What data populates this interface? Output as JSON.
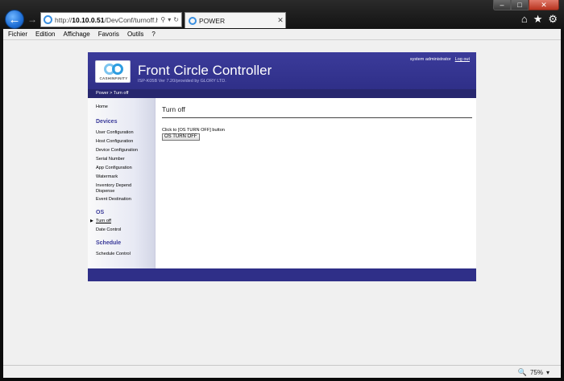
{
  "browser": {
    "address_prefix": "http://",
    "address_host": "10.10.0.51",
    "address_path": "/DevConf/turnoff.htm",
    "tab_title": "POWER",
    "menu": [
      "Fichier",
      "Edition",
      "Affichage",
      "Favoris",
      "Outils",
      "?"
    ],
    "zoom": "75%"
  },
  "header": {
    "logo_text": "CASHINFINITY",
    "title": "Front Circle Controller",
    "subtitle": "ISP-K05B Ver 7.20/provided by GLORY LTD.",
    "user": "system administrator",
    "logout": "Log out"
  },
  "breadcrumb": "Power > Turn off",
  "sidebar": {
    "home": "Home",
    "devices_heading": "Devices",
    "devices": [
      "User Configuration",
      "Host Configuration",
      "Device Configuration",
      "Serial Number",
      "App Configuration",
      "Watermark",
      "Inventory Depend",
      "Dispense",
      "Event Destination"
    ],
    "os_heading": "OS",
    "os": [
      "Turn off",
      "Date Control"
    ],
    "schedule_heading": "Schedule",
    "schedule": [
      "Schedule Control"
    ]
  },
  "content": {
    "title": "Turn off",
    "message": "Click to [OS TURN OFF] button",
    "button": "OS TURN OFF"
  },
  "colors": {
    "header_bg": "#3b3b9a",
    "breadcrumb_bg": "#27276e",
    "accent": "#3b3b9a"
  }
}
